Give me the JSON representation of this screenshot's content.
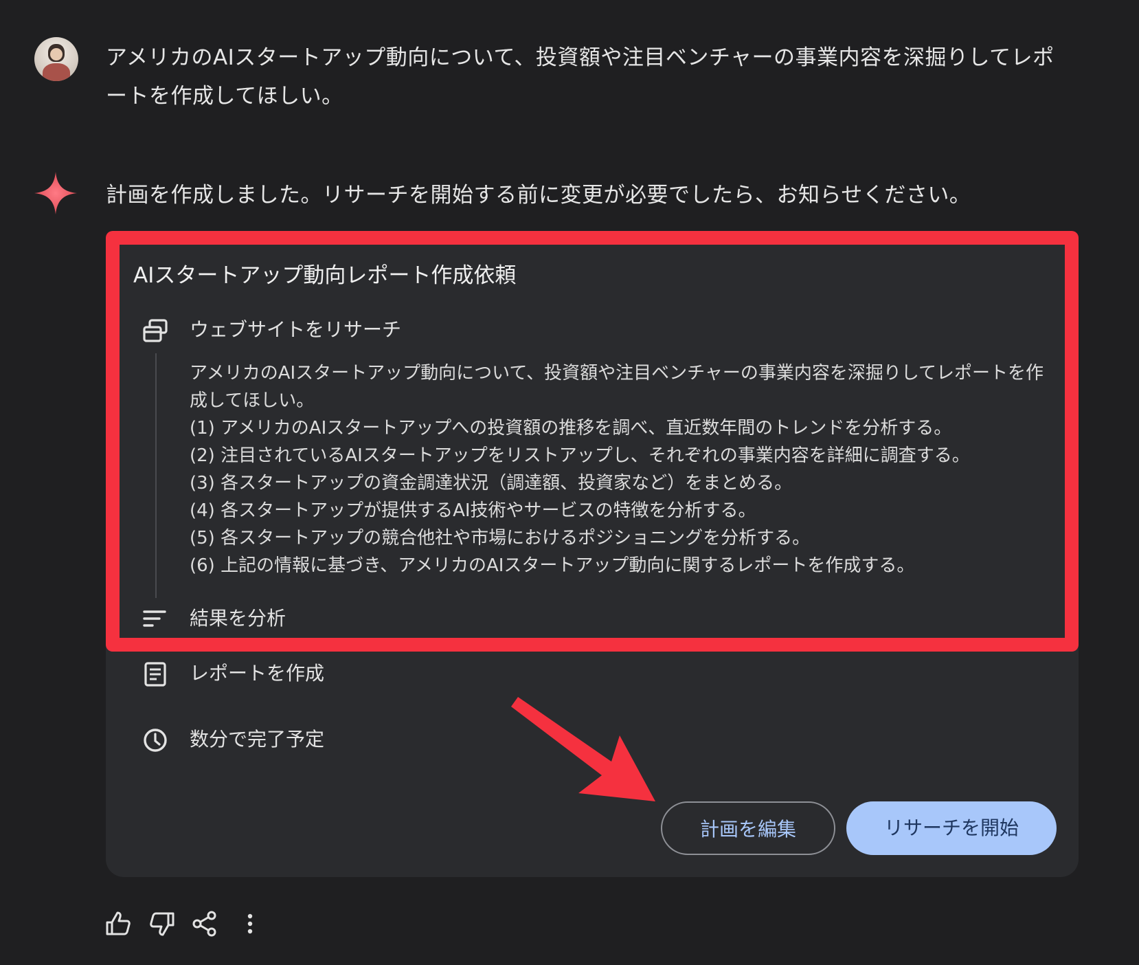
{
  "user_prompt": {
    "line1": "アメリカのAIスタートアップ動向について、投資額や注目ベンチャーの事業内容を深掘りしてレポ",
    "line2": "ートを作成してほしい。"
  },
  "reply": {
    "text": "計画を作成しました。リサーチを開始する前に変更が必要でしたら、お知らせください。"
  },
  "plan": {
    "title": "AIスタートアップ動向レポート作成依頼",
    "steps": [
      {
        "icon": "web-search-icon",
        "label": "ウェブサイトをリサーチ"
      },
      {
        "icon": "analyze-icon",
        "label": "結果を分析"
      },
      {
        "icon": "report-icon",
        "label": "レポートを作成"
      }
    ],
    "detail": {
      "intro": "アメリカのAIスタートアップ動向について、投資額や注目ベンチャーの事業内容を深掘りしてレポートを作成してほしい。",
      "items": [
        "(1) アメリカのAIスタートアップへの投資額の推移を調べ、直近数年間のトレンドを分析する。",
        "(2) 注目されているAIスタートアップをリストアップし、それぞれの事業内容を詳細に調査する。",
        "(3) 各スタートアップの資金調達状況（調達額、投資家など）をまとめる。",
        "(4) 各スタートアップが提供するAI技術やサービスの特徴を分析する。",
        "(5) 各スタートアップの競合他社や市場におけるポジショニングを分析する。",
        "(6) 上記の情報に基づき、アメリカのAIスタートアップ動向に関するレポートを作成する。"
      ]
    },
    "eta": {
      "icon": "clock-icon",
      "label": "数分で完了予定"
    },
    "buttons": {
      "edit": "計画を編集",
      "start": "リサーチを開始"
    }
  },
  "colors": {
    "background": "#1f1f21",
    "card": "#2a2b2e",
    "highlight": "#f5313f",
    "accent": "#a8c7fa"
  },
  "feedback_icons": [
    "thumbs-up-icon",
    "thumbs-down-icon",
    "share-icon",
    "more-vert-icon"
  ]
}
